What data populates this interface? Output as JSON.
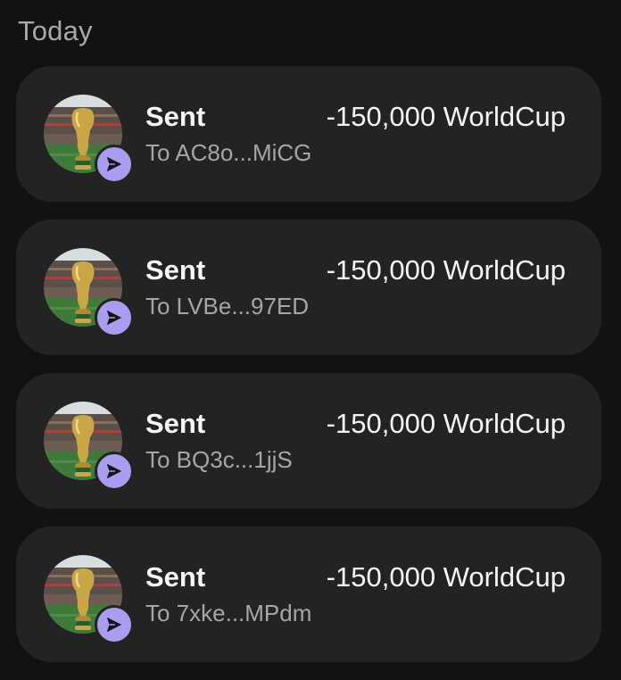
{
  "section": {
    "title": "Today"
  },
  "transactions": [
    {
      "type": "Sent",
      "amount": "-150,000 WorldCup",
      "recipient": "To AC8o...MiCG",
      "avatar_icon": "world-cup-trophy-icon",
      "badge_icon": "send-arrow-icon"
    },
    {
      "type": "Sent",
      "amount": "-150,000 WorldCup",
      "recipient": "To LVBe...97ED",
      "avatar_icon": "world-cup-trophy-icon",
      "badge_icon": "send-arrow-icon"
    },
    {
      "type": "Sent",
      "amount": "-150,000 WorldCup",
      "recipient": "To BQ3c...1jjS",
      "avatar_icon": "world-cup-trophy-icon",
      "badge_icon": "send-arrow-icon"
    },
    {
      "type": "Sent",
      "amount": "-150,000 WorldCup",
      "recipient": "To 7xke...MPdm",
      "avatar_icon": "world-cup-trophy-icon",
      "badge_icon": "send-arrow-icon"
    }
  ],
  "colors": {
    "background": "#121212",
    "card": "#232323",
    "badge_accent": "#a99df0",
    "secondary_text": "#a6a6a6"
  }
}
